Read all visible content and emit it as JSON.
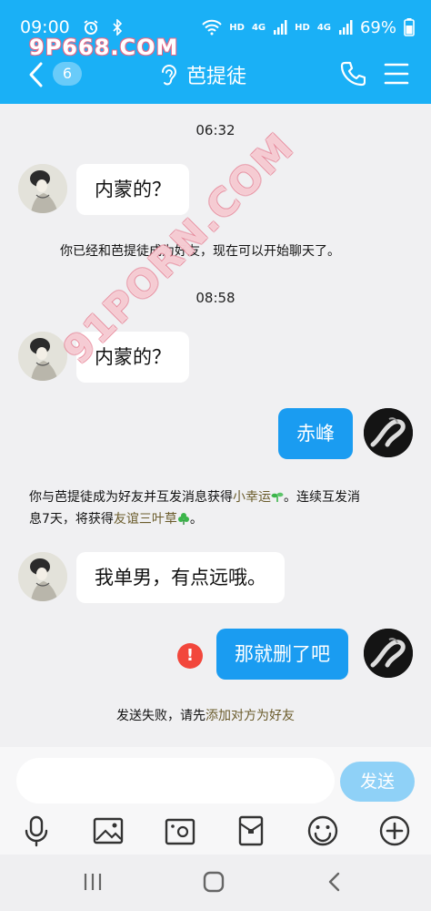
{
  "status": {
    "time": "09:00",
    "hd1": "HD",
    "net1": "4G",
    "hd2": "HD",
    "net2": "4G",
    "battery": "69%"
  },
  "watermark": {
    "top": "9P668.COM",
    "diagonal": "91PORN.COM"
  },
  "header": {
    "unread_count": "6",
    "title": "芭提徒"
  },
  "messages": {
    "time1": "06:32",
    "msg1": "内蒙的？",
    "sys1": "你已经和芭提徒成为好友，现在可以开始聊天了。",
    "time2": "08:58",
    "msg2": "内蒙的？",
    "msg3": "赤峰",
    "sys2_line1a": "你与芭提徒成为好友并互发消息获得",
    "sys2_hl1": "小幸运",
    "sys2_line1b": "。连续互发消",
    "sys2_line2a": "息7天，将获得",
    "sys2_hl2": "友谊三叶草",
    "sys2_line2b": "。",
    "msg4": "我单男，有点远哦。",
    "msg5": "那就删了吧",
    "error_mark": "!",
    "sys3a": "发送失败，请先",
    "sys3_hl": "添加对方为好友"
  },
  "input": {
    "placeholder": "",
    "send_label": "发送"
  },
  "icons": {
    "back": "chevron-left-icon",
    "ear": "ear-icon",
    "phone": "phone-icon",
    "menu": "menu-icon",
    "mic": "microphone-icon",
    "image": "image-icon",
    "camera": "camera-icon",
    "red_packet": "red-packet-icon",
    "emoji": "emoji-icon",
    "plus": "plus-icon"
  },
  "colors": {
    "header": "#1ab0f6",
    "bubble_out": "#1a9cf1",
    "send_button": "#8fd1f7",
    "error": "#f2473c"
  }
}
